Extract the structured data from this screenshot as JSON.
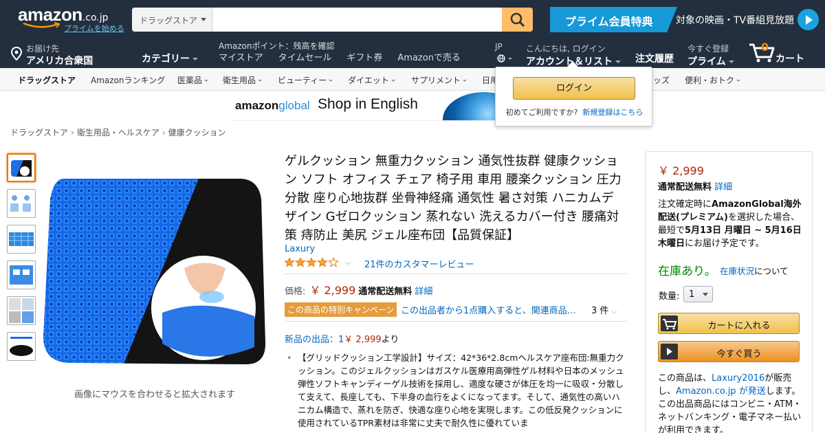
{
  "header": {
    "logo_text": "amazon",
    "logo_tld": ".co.jp",
    "prime_start": "プライムを始める",
    "search_dept": "ドラッグストア",
    "search_value": "",
    "prime_banner_left": "プライム会員特典",
    "prime_banner_right": "対象の映画・TV番組見放題"
  },
  "nav": {
    "deliver_line1": "お届け先",
    "deliver_line2": "アメリカ合衆国",
    "category": "カテゴリー",
    "points": "Amazonポイント：残高を確認",
    "links": [
      "マイストア",
      "タイムセール",
      "ギフト券",
      "Amazonで売る"
    ],
    "lang": "JP",
    "account_line1": "こんにちは, ログイン",
    "account_line2": "アカウント＆リスト",
    "orders": "注文履歴",
    "prime_line1": "今すぐ登録",
    "prime_line2": "プライム",
    "cart_count": "0",
    "cart_label": "カート"
  },
  "subnav": {
    "store": "ドラッグストア",
    "items": [
      "Amazonランキング",
      "医薬品",
      "衛生用品",
      "ビューティー",
      "ダイエット",
      "サプリメント",
      "日用",
      "ッズ",
      "便利・おトク"
    ]
  },
  "banner": {
    "brand_bold": "amazon",
    "brand_light": "global",
    "shop": "Shop in English"
  },
  "flyout": {
    "signin": "ログイン",
    "new_prefix": "初めてご利用ですか?",
    "new_link": "新規登録はこちら"
  },
  "breadcrumb": [
    "ドラッグストア",
    "衛生用品・ヘルスケア",
    "健康クッション"
  ],
  "gallery": {
    "hint": "画像にマウスを合わせると拡大されます"
  },
  "product": {
    "title": "ゲルクッション 無重力クッション 通気性抜群 健康クッション ソフト オフィス チェア 椅子用 車用 腰楽クッション 圧力分散 座り心地抜群 坐骨神経痛 通気性 暑さ対策 ハニカムデザイン Gゼロクッション 蒸れない 洗えるカバー付き 腰痛対策 痔防止 美尻 ジェル座布団【品質保証】",
    "brand": "Laxury",
    "rating": 4,
    "review_text": "21件のカスタマーレビュー",
    "price_label": "価格:",
    "price": "￥ 2,999",
    "free_shipping": "通常配送無料",
    "details": "詳細",
    "promo_badge": "この商品の特別キャンペーン",
    "promo_text": "この出品者から1点購入すると、関連商品…",
    "promo_count": "3 件",
    "new_offers_link": "新品の出品：1",
    "new_offers_price": "￥ 2,999",
    "new_offers_suffix": "より",
    "bullet": "【グリッドクッション工学設計】サイズ：42*36*2.8cmヘルスケア座布団:無重力クッション。このジェルクッションはガスケル医療用高弾性ゲル材料や日本のメッシュ弾性ソフトキャンディーゲル技術を採用し、適度な硬さが体圧を均一に吸収・分散して支えて、長座しても、下半身の血行をよくになってます。そして、通気性の高いハニカム構造で、蒸れを防ぎ、快適な座り心地を実現します。この低反発クッションに使用されているTPR素材は非常に丈夫で耐久性に優れていま"
  },
  "buybox": {
    "price": "￥ 2,999",
    "free": "通常配送無料",
    "details": "詳細",
    "note_1": "注文確定時に",
    "note_bold": "AmazonGlobal海外配送(プレミアム)",
    "note_2": "を選択した場合、最短で",
    "note_date": "5月13日 月曜日 ~ 5月16日 木曜日",
    "note_3": "にお届け予定です。",
    "stock": "在庫あり。",
    "stock_link": "在庫状況",
    "stock_suffix": "について",
    "qty_label": "数量:",
    "qty_value": "1",
    "add_to_cart": "カートに入れる",
    "buy_now": "今すぐ買う",
    "seller_1": "この商品は、",
    "seller_name": "Laxury2016",
    "seller_2": "が販売し、",
    "shipper": "Amazon.co.jp が発送",
    "seller_3": "します。この出品商品にはコンビニ・ATM・ネットバンキング・電子マネー払いが利用できます。"
  },
  "colors": {
    "nav_bg": "#232f3e",
    "accent": "#febd69",
    "price": "#b12704",
    "link": "#0066c0",
    "stock": "#008a00"
  }
}
